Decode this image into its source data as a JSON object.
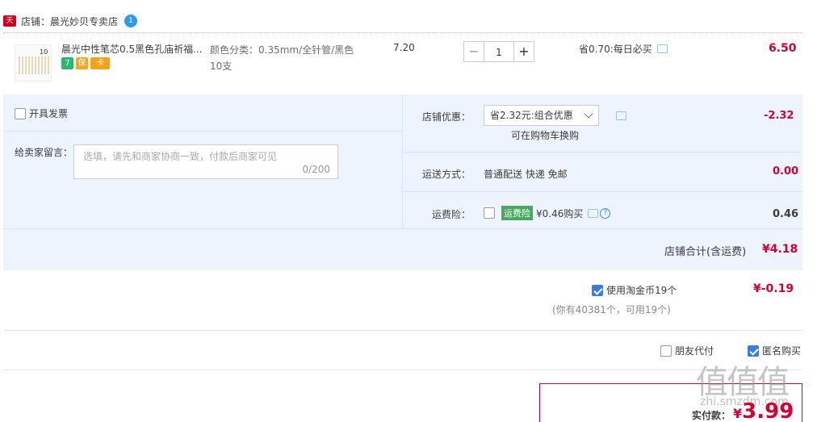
{
  "shop": {
    "tmall_badge": "天猫",
    "name": "店铺：晨光妙贝专卖店",
    "ww_badge": "1"
  },
  "item": {
    "thumb_text": "10支",
    "title": "晨光中性笔芯0.5黑色孔庙祈福...",
    "badges": [
      "7",
      "保",
      "卡"
    ],
    "spec": "颜色分类：0.35mm/全针管/黑色10支",
    "unit_price": "7.20",
    "qty_minus": "−",
    "qty_value": "1",
    "qty_plus": "+",
    "saving": "省0.70:每日必买",
    "total": "6.50"
  },
  "invoice": {
    "label": "开具发票"
  },
  "note": {
    "label": "给卖家留言：",
    "placeholder": "选填，请先和商家协商一致，付款后商家可见",
    "counter": "0/200"
  },
  "promo": {
    "label": "店铺优惠：",
    "selected": "省2.32元:组合优惠",
    "tip": "可在购物车换购",
    "value": "-2.32"
  },
  "shipping": {
    "label": "运送方式：",
    "text": "普通配送 快递 免邮",
    "value": "0.00"
  },
  "insurance": {
    "label": "运费险：",
    "tag": "运费险",
    "text": "¥0.46购买",
    "help": "?",
    "value": "0.46"
  },
  "shop_total": {
    "label": "店铺合计(含运费)",
    "value": "¥4.18"
  },
  "coins": {
    "label": "使用淘金币19个",
    "value": "¥-0.19",
    "note": "(你有40381个，可用19个)",
    "checked": true
  },
  "options": {
    "friend_pay": "朋友代付",
    "anonymous": "匿名购买"
  },
  "payment": {
    "label": "实付款：",
    "currency": "¥",
    "value": "3.99"
  },
  "watermark": {
    "main": "值值值",
    "sub": "zhi.smzdm.com"
  },
  "colors": {
    "price_red": "#d40031",
    "panel_bg": "#eef4fd",
    "checkbox_blue": "#3a7de0",
    "tag_green": "#48a85e"
  }
}
